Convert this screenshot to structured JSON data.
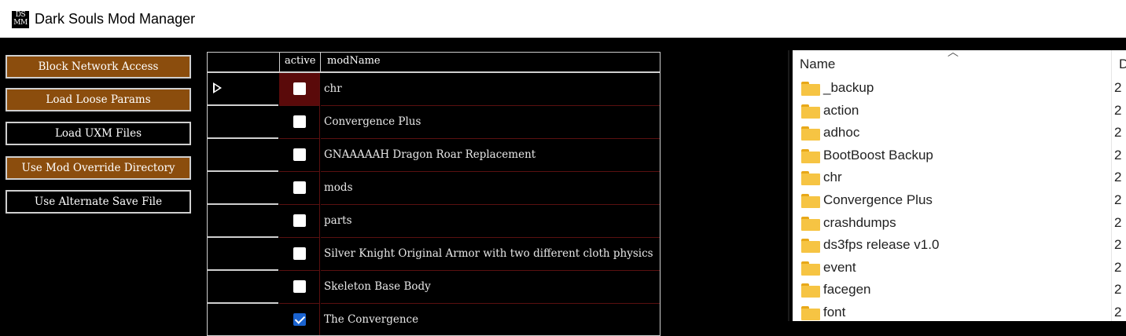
{
  "window": {
    "title": "Dark Souls Mod Manager",
    "icon_text": "DS MM"
  },
  "buttons": [
    {
      "label": "Block Network Access",
      "active": true
    },
    {
      "label": "Load Loose Params",
      "active": true
    },
    {
      "label": "Load UXM Files",
      "active": false
    },
    {
      "label": "Use Mod Override Directory",
      "active": true
    },
    {
      "label": "Use Alternate Save File",
      "active": false
    }
  ],
  "grid": {
    "columns": {
      "active": "active",
      "modName": "modName"
    },
    "rows": [
      {
        "name": "chr",
        "checked": false,
        "selected": true
      },
      {
        "name": "Convergence Plus",
        "checked": false
      },
      {
        "name": "GNAAAAAH Dragon Roar Replacement",
        "checked": false
      },
      {
        "name": "mods",
        "checked": false
      },
      {
        "name": "parts",
        "checked": false
      },
      {
        "name": "Silver Knight Original Armor with two different cloth physics",
        "checked": false
      },
      {
        "name": "Skeleton Base Body",
        "checked": false
      },
      {
        "name": "The Convergence",
        "checked": true
      }
    ]
  },
  "explorer": {
    "column_name": "Name",
    "column_date_partial": "D",
    "folders": [
      {
        "name": "_backup",
        "date_partial": "2"
      },
      {
        "name": "action",
        "date_partial": "2"
      },
      {
        "name": "adhoc",
        "date_partial": "2"
      },
      {
        "name": "BootBoost Backup",
        "date_partial": "2"
      },
      {
        "name": "chr",
        "date_partial": "2"
      },
      {
        "name": "Convergence Plus",
        "date_partial": "2"
      },
      {
        "name": "crashdumps",
        "date_partial": "2"
      },
      {
        "name": "ds3fps release v1.0",
        "date_partial": "2"
      },
      {
        "name": "event",
        "date_partial": "2"
      },
      {
        "name": "facegen",
        "date_partial": "2"
      },
      {
        "name": "font",
        "date_partial": "2"
      }
    ]
  },
  "colors": {
    "button_active": "#8b4d0d",
    "selected_cell": "#5a0a0a",
    "checkbox_checked": "#1a63d0",
    "folder": "#f6c443"
  }
}
